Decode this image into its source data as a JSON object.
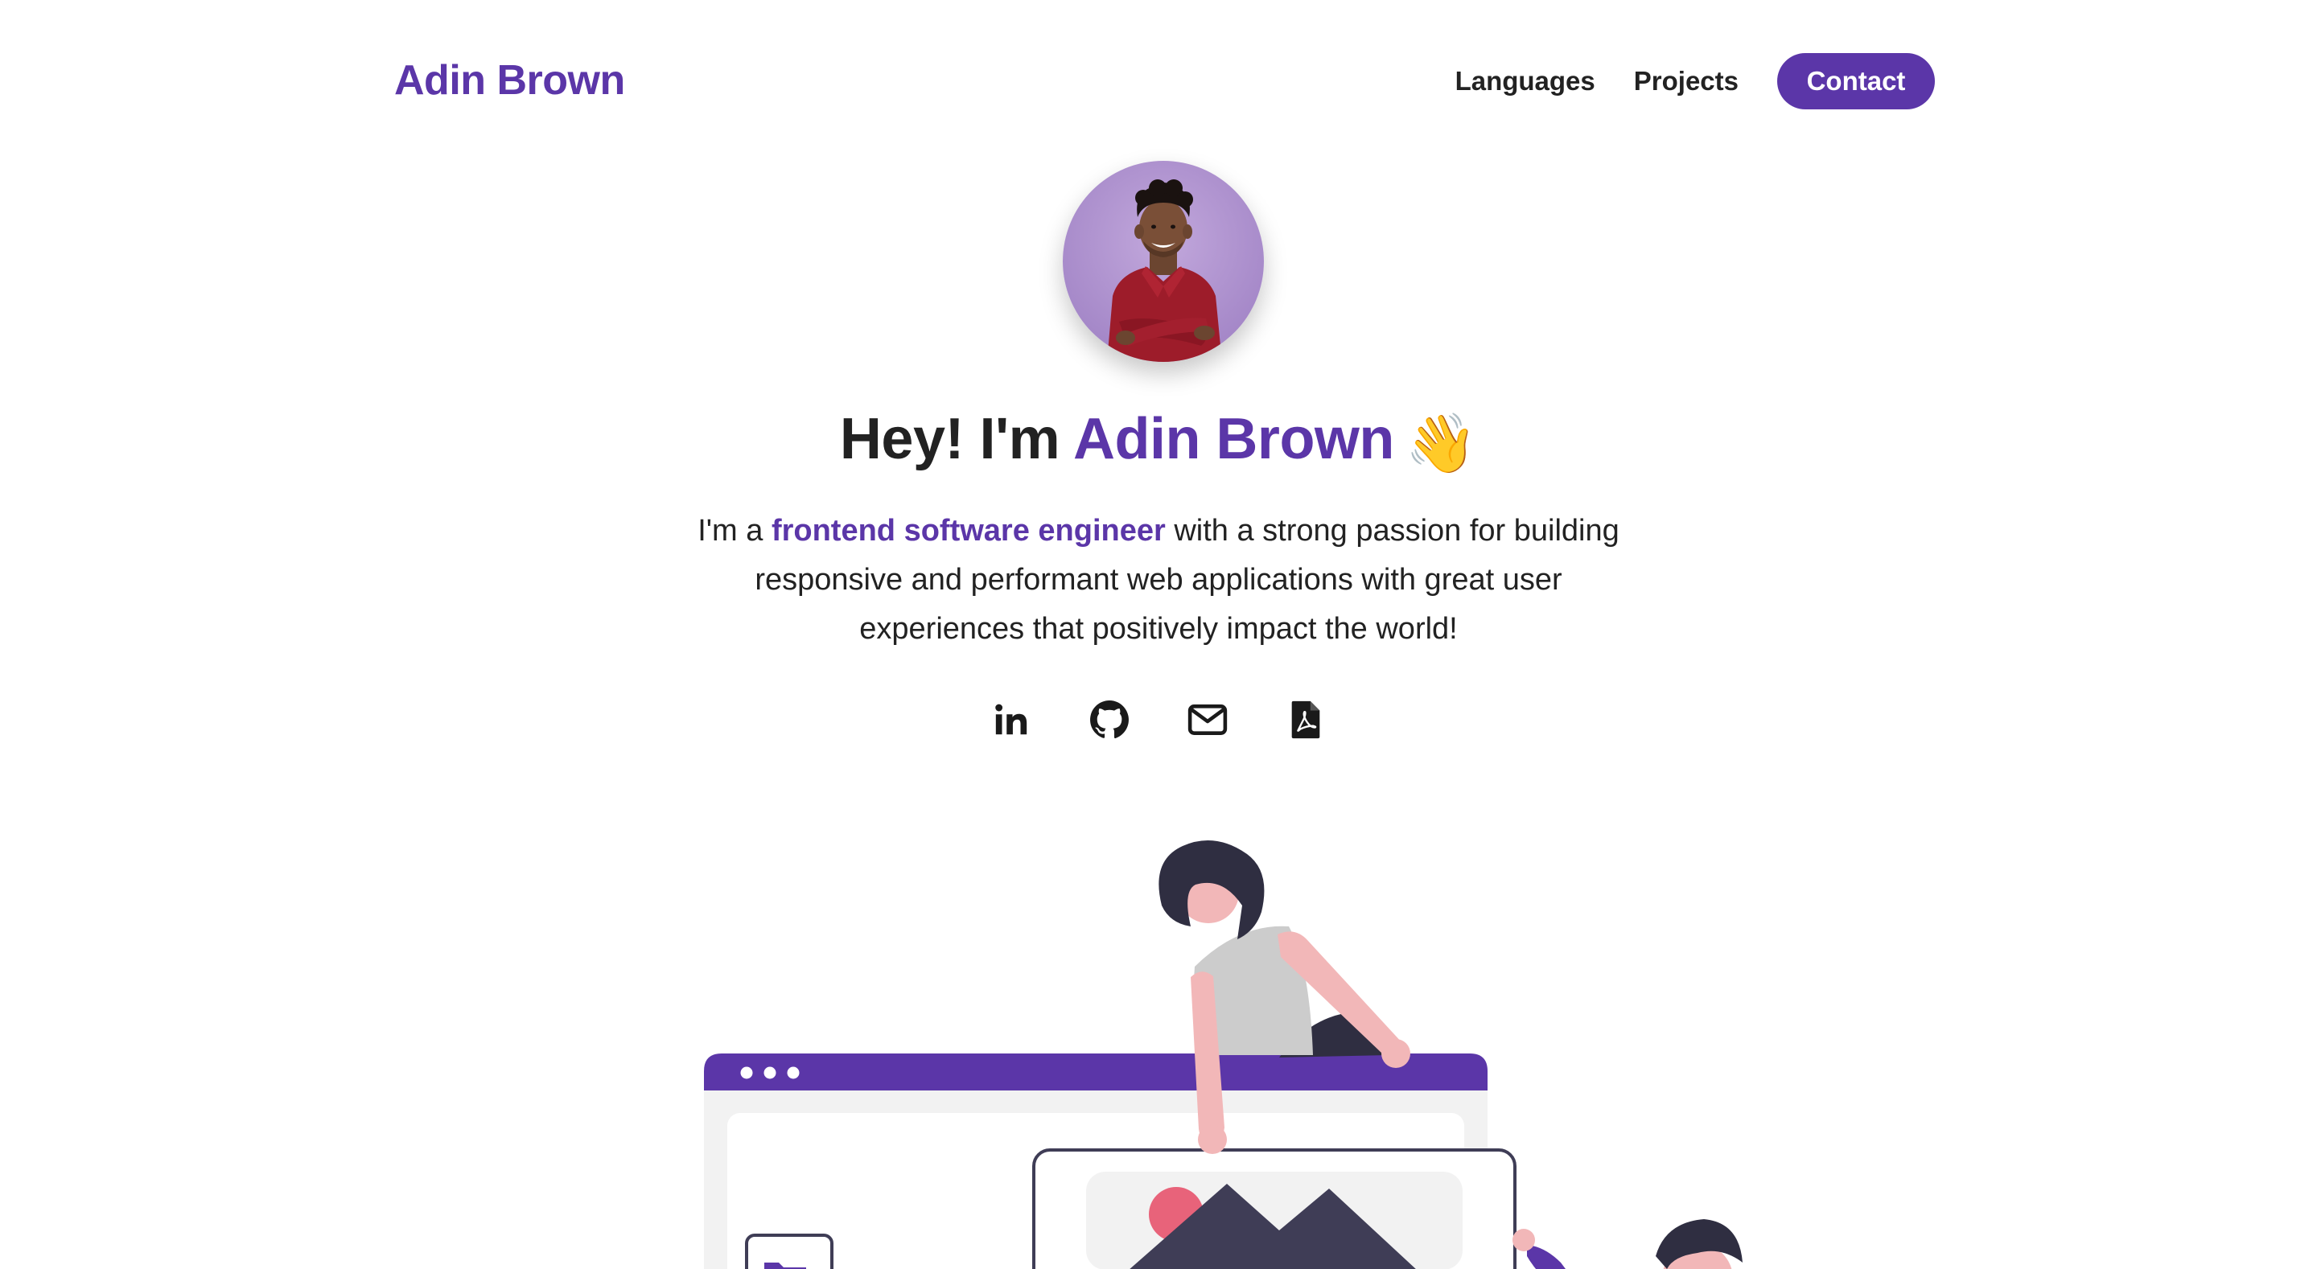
{
  "header": {
    "brand": "Adin Brown",
    "nav": {
      "languages": "Languages",
      "projects": "Projects",
      "contact": "Contact"
    }
  },
  "hero": {
    "title_prefix": "Hey! I'm ",
    "title_name": "Adin Brown",
    "wave_emoji": "👋",
    "bio_prefix": "I'm a ",
    "bio_highlight": "frontend software engineer",
    "bio_suffix": " with a strong passion for building responsive and performant web applications with great user experiences that positively impact the world!"
  },
  "social": {
    "icons": [
      "linkedin-icon",
      "github-icon",
      "mail-icon",
      "pdf-resume-icon"
    ]
  },
  "colors": {
    "accent": "#5b36a8",
    "text": "#222222",
    "background": "#ffffff"
  }
}
